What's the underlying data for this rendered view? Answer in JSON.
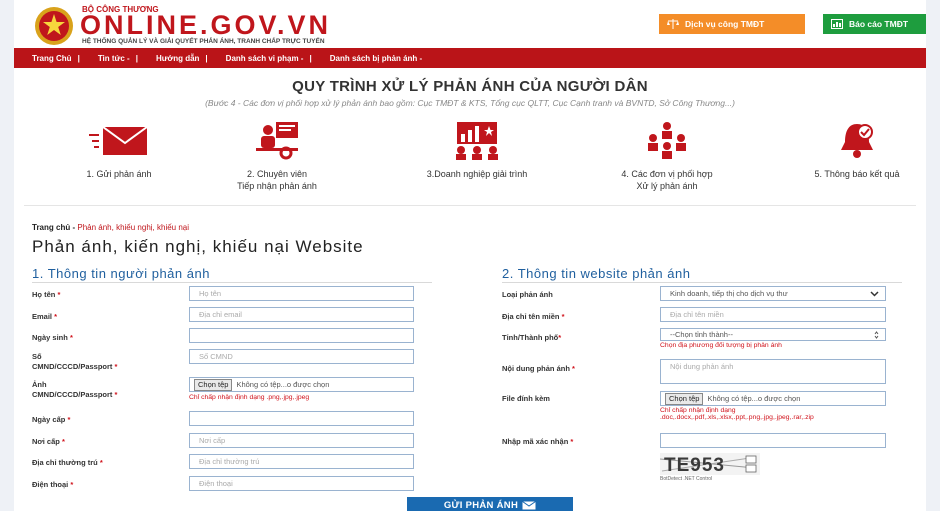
{
  "header": {
    "ministry": "BỘ CÔNG THƯƠNG",
    "site_name": "ONLINE.GOV.VN",
    "tagline": "HỆ THỐNG QUẢN LÝ VÀ GIẢI QUYẾT PHẢN ÁNH, TRANH CHẤP TRỰC TUYẾN",
    "btn_service": "Dịch vụ công TMĐT",
    "btn_report": "Báo cáo TMĐT"
  },
  "nav": {
    "items": [
      "Trang Chủ",
      "Tin tức -",
      "Hướng dẫn",
      "Danh sách vi phạm -",
      "Danh sách bị phản ánh -"
    ]
  },
  "process": {
    "title": "QUY TRÌNH XỬ LÝ PHẢN ÁNH CỦA NGƯỜI DÂN",
    "subtitle": "(Bước 4 - Các đơn vị phối hợp xử lý phản ánh bao gồm: Cục TMĐT & KTS, Tổng cục QLTT, Cục Cạnh tranh và BVNTD, Sở Công Thương...)",
    "steps": [
      {
        "line1": "1. Gửi phản ánh",
        "line2": ""
      },
      {
        "line1": "2. Chuyên viên",
        "line2": "Tiếp nhận phản ánh"
      },
      {
        "line1": "3.Doanh nghiệp giải trình",
        "line2": ""
      },
      {
        "line1": "4. Các đơn vị phối hợp",
        "line2": "Xử lý phản ánh"
      },
      {
        "line1": "5. Thông báo kết quả",
        "line2": ""
      }
    ]
  },
  "breadcrumb": {
    "home": "Trang chủ",
    "sep": "-",
    "current": "Phản ánh, khiếu nghị, khiếu nại"
  },
  "page_title": "Phản ánh, kiến nghị, khiếu nại Website",
  "section1": {
    "title": "1. Thông tin người phản ánh",
    "fields": {
      "name": {
        "label": "Họ tên",
        "placeholder": "Họ tên"
      },
      "email": {
        "label": "Email",
        "placeholder": "Địa chỉ email"
      },
      "dob": {
        "label": "Ngày sinh",
        "placeholder": ""
      },
      "id_no": {
        "label1": "Số",
        "label2": "CMND/CCCD/Passport",
        "placeholder": "Số CMND"
      },
      "id_img": {
        "label1": "Ảnh",
        "label2": "CMND/CCCD/Passport",
        "button": "Chọn tệp",
        "status": "Không có tệp...o được chọn",
        "hint": "Chỉ chấp nhận định dạng .png,.jpg,.jpeg"
      },
      "issue_date": {
        "label": "Ngày cấp",
        "placeholder": ""
      },
      "issue_place": {
        "label": "Nơi cấp",
        "placeholder": "Nơi cấp"
      },
      "address": {
        "label": "Địa chỉ thường trú",
        "placeholder": "Địa chỉ thường trú"
      },
      "phone": {
        "label": "Điện thoại",
        "placeholder": "Điện thoại"
      }
    }
  },
  "section2": {
    "title": "2. Thông tin website phản ánh",
    "fields": {
      "type": {
        "label": "Loại phản ánh",
        "value": "Kinh doanh, tiếp thị cho dịch vụ thư"
      },
      "domain": {
        "label": "Địa chỉ tên miền",
        "placeholder": "Địa chỉ tên miền"
      },
      "province": {
        "label": "Tỉnh/Thành phố",
        "value": "--Chọn tỉnh thành--",
        "hint": "Chọn địa phương đối tượng bị phản ánh"
      },
      "content": {
        "label": "Nội dung phản ánh",
        "placeholder": "Nội dung phản ánh"
      },
      "attachment": {
        "label": "File đính kèm",
        "button": "Chọn tệp",
        "status": "Không có tệp...o được chọn",
        "hint1": "Chỉ chấp nhận định dạng",
        "hint2": ".doc,.docx,.pdf,.xls,.xlsx,.ppt,.png,.jpg,.jpeg,.rar,.zip"
      },
      "captcha": {
        "label": "Nhập mã xác nhận",
        "placeholder": "",
        "code": "TE953",
        "caption": "BotDetect .NET Control"
      }
    }
  },
  "submit_label": "GỬI PHẢN ÁNH",
  "colors": {
    "brand_red": "#c0161c",
    "nav_red": "#ba1418",
    "orange": "#f48d28",
    "green": "#1e9d3e",
    "blue": "#1a6ab1",
    "section_blue": "#1f5f9e"
  }
}
